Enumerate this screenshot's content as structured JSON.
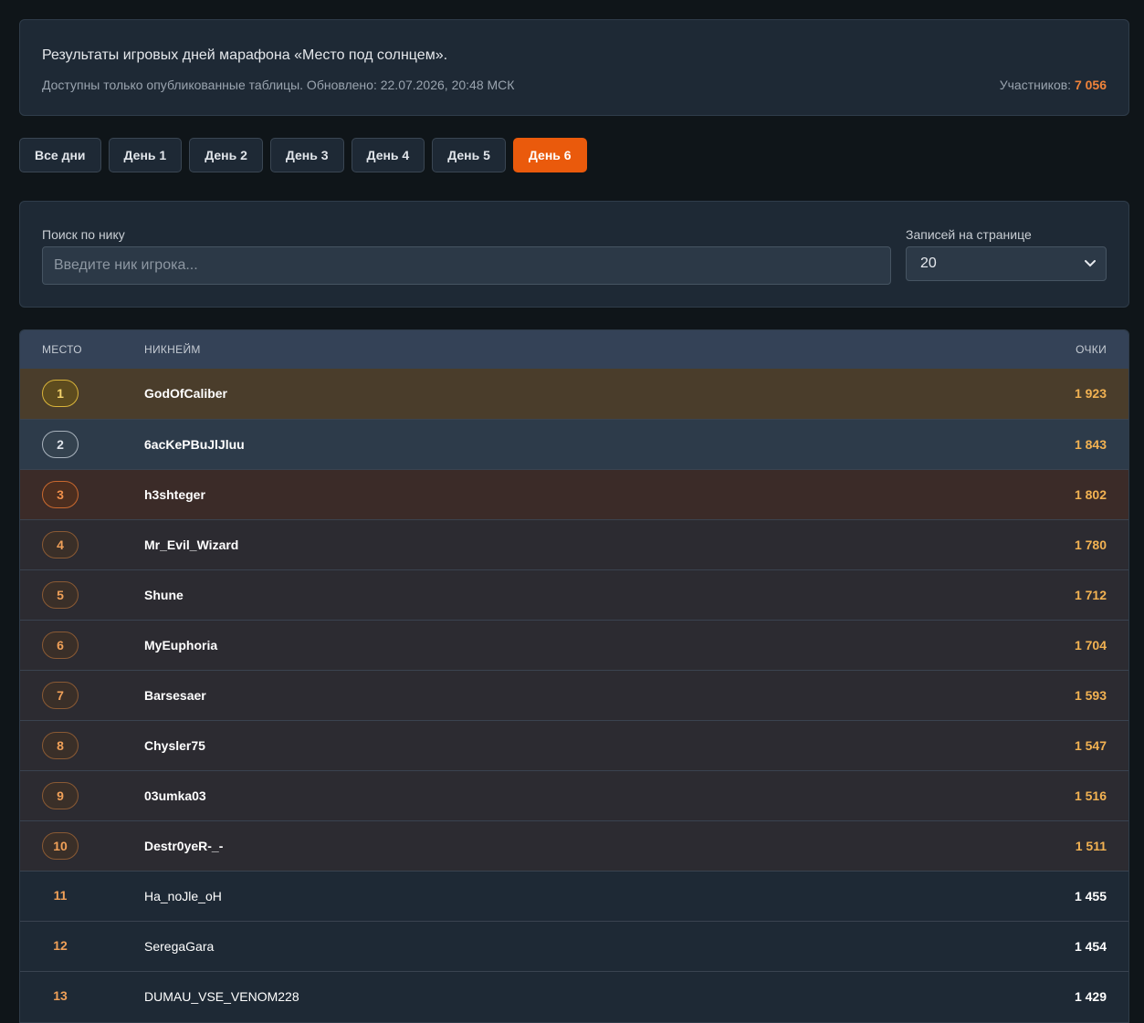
{
  "header": {
    "title": "Результаты игровых дней марафона «Место под солнцем».",
    "subtitle": "Доступны только опубликованные таблицы. Обновлено: 22.07.2026, 20:48 МСК",
    "participants_label": "Участников:",
    "participants_value": "7 056"
  },
  "tabs": [
    "Все дни",
    "День 1",
    "День 2",
    "День 3",
    "День 4",
    "День 5",
    "День 6"
  ],
  "active_tab": "День 6",
  "filters": {
    "search_label": "Поиск по нику",
    "search_placeholder": "Введите ник игрока...",
    "search_value": "",
    "per_page_label": "Записей на странице",
    "per_page_value": "20"
  },
  "table": {
    "columns": {
      "place": "МЕСТО",
      "nickname": "НИКНЕЙМ",
      "points": "ОЧКИ"
    },
    "rows": [
      {
        "place": "1",
        "nickname": "GodOfCaliber",
        "points": "1 923"
      },
      {
        "place": "2",
        "nickname": "6acKePBuJlJluu",
        "points": "1 843"
      },
      {
        "place": "3",
        "nickname": "h3shteger",
        "points": "1 802"
      },
      {
        "place": "4",
        "nickname": "Mr_Evil_Wizard",
        "points": "1 780"
      },
      {
        "place": "5",
        "nickname": "Shune",
        "points": "1 712"
      },
      {
        "place": "6",
        "nickname": "MyEuphoria",
        "points": "1 704"
      },
      {
        "place": "7",
        "nickname": "Barsesaer",
        "points": "1 593"
      },
      {
        "place": "8",
        "nickname": "Chysler75",
        "points": "1 547"
      },
      {
        "place": "9",
        "nickname": "03umka03",
        "points": "1 516"
      },
      {
        "place": "10",
        "nickname": "Destr0yeR-_-",
        "points": "1 511"
      },
      {
        "place": "11",
        "nickname": "Ha_noJle_oH",
        "points": "1 455"
      },
      {
        "place": "12",
        "nickname": "SeregaGara",
        "points": "1 454"
      },
      {
        "place": "13",
        "nickname": "DUMAU_VSE_VENOM228",
        "points": "1 429"
      }
    ]
  },
  "colors": {
    "accent": "#ea5a0c",
    "gold_row": "#4a3d2b",
    "silver_row": "#2d3b4a",
    "bronze_row": "#3b2b28",
    "top_row": "#2c2b31"
  }
}
